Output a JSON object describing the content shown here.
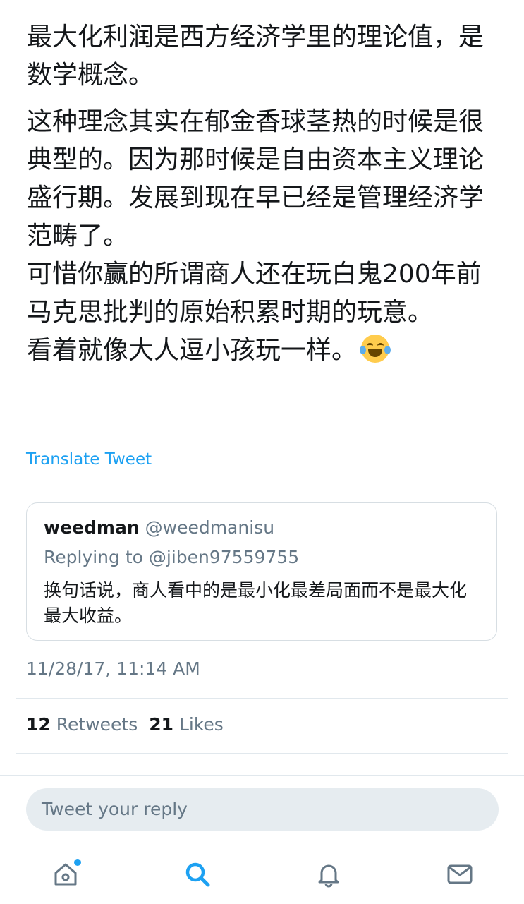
{
  "tweet": {
    "paragraph1": "最大化利润是西方经济学里的理论值，是数学概念。",
    "paragraph2": "这种理念其实在郁金香球茎热的时候是很典型的。因为那时候是自由资本主义理论盛行期。发展到现在早已经是管理经济学范畴了。",
    "paragraph3": "可惜你赢的所谓商人还在玩白鬼200年前马克思批判的原始积累时期的玩意。",
    "paragraph4": "看着就像大人逗小孩玩一样。",
    "emoji_icon": "face-with-tears-of-joy",
    "translate_label": "Translate Tweet",
    "timestamp": "11/28/17, 11:14 AM"
  },
  "quoted_tweet": {
    "name": "weedman",
    "handle": "@weedmanisu",
    "replying_to": "Replying to @jiben97559755",
    "text": "换句话说，商人看中的是最小化最差局面而不是最大化最大收益。"
  },
  "stats": {
    "retweets_count": "12",
    "retweets_label": "Retweets",
    "likes_count": "21",
    "likes_label": "Likes"
  },
  "reply": {
    "placeholder": "Tweet your reply"
  },
  "tabbar": {
    "items": [
      {
        "icon": "home-icon",
        "active": false,
        "notification_dot": true
      },
      {
        "icon": "search-icon",
        "active": true
      },
      {
        "icon": "notifications-bell-icon",
        "active": false
      },
      {
        "icon": "messages-envelope-icon",
        "active": false
      }
    ]
  },
  "colors": {
    "accent": "#1da1f2",
    "secondary_text": "#657786",
    "primary_text": "#14171a",
    "input_bg": "#e6ecf0"
  }
}
